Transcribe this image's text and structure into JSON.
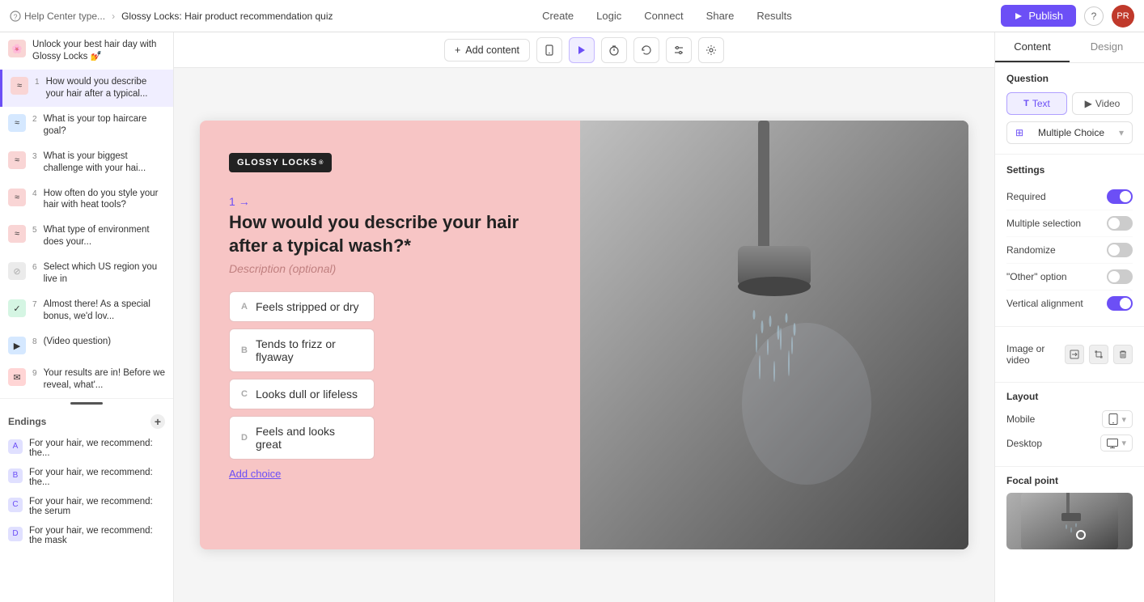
{
  "topnav": {
    "help_center": "Help Center type...",
    "breadcrumb_sep": "›",
    "breadcrumb_current": "Glossy Locks: Hair product recommendation quiz",
    "nav_items": [
      "Create",
      "Logic",
      "Connect",
      "Share",
      "Results"
    ],
    "publish_label": "Publish",
    "avatar_initials": "PR"
  },
  "sidebar": {
    "questions": [
      {
        "num": "",
        "text": "Unlock your best hair day with Glossy Locks 💅",
        "icon_type": "pink",
        "icon": "🌸"
      },
      {
        "num": "1",
        "text": "How would you describe your hair after a typical...",
        "icon_type": "pink",
        "icon": "≈"
      },
      {
        "num": "2",
        "text": "What is your top haircare goal?",
        "icon_type": "blue",
        "icon": "≈"
      },
      {
        "num": "3",
        "text": "What is your biggest challenge with your hai...",
        "icon_type": "pink",
        "icon": "≈"
      },
      {
        "num": "4",
        "text": "How often do you style your hair with heat tools?",
        "icon_type": "pink",
        "icon": "≈"
      },
      {
        "num": "5",
        "text": "What type of environment does your...",
        "icon_type": "pink",
        "icon": "≈"
      },
      {
        "num": "6",
        "text": "Select which US region you live in",
        "icon_type": "gray",
        "icon": "⊘"
      },
      {
        "num": "7",
        "text": "Almost there! As a special bonus, we'd lov...",
        "icon_type": "green",
        "icon": "✓"
      },
      {
        "num": "8",
        "text": "(Video question)",
        "icon_type": "blue",
        "icon": "▶"
      },
      {
        "num": "9",
        "text": "Your results are in! Before we reveal, what'...",
        "icon_type": "red",
        "icon": "✉"
      }
    ],
    "endings_label": "Endings",
    "endings": [
      {
        "badge": "A",
        "text": "For your hair, we recommend: the..."
      },
      {
        "badge": "B",
        "text": "For your hair, we recommend: the..."
      },
      {
        "badge": "C",
        "text": "For your hair, we recommend: the serum"
      },
      {
        "badge": "D",
        "text": "For your hair, we recommend: the mask"
      }
    ]
  },
  "toolbar": {
    "add_content_label": "+ Add content",
    "buttons": [
      "mobile",
      "play",
      "timer",
      "refresh",
      "settings-sliders",
      "gear"
    ]
  },
  "canvas": {
    "logo_text": "GLOSSY LOCKS",
    "logo_sup": "®",
    "question_num": "1",
    "question_arrow": "→",
    "question_text": "How would you describe your hair after a typical wash?*",
    "description_placeholder": "Description (optional)",
    "choices": [
      {
        "letter": "A",
        "text": "Feels stripped or dry"
      },
      {
        "letter": "B",
        "text": "Tends to frizz or flyaway"
      },
      {
        "letter": "C",
        "text": "Looks dull or lifeless"
      },
      {
        "letter": "D",
        "text": "Feels and looks great"
      }
    ],
    "add_choice_label": "Add choice"
  },
  "right_panel": {
    "tabs": [
      "Content",
      "Design"
    ],
    "active_tab": "Content",
    "question_section_title": "Question",
    "type_buttons": [
      {
        "label": "Text",
        "icon": "T",
        "active": true
      },
      {
        "label": "Video",
        "icon": "▶",
        "active": false
      }
    ],
    "multiple_choice_label": "Multiple Choice",
    "settings_title": "Settings",
    "settings": [
      {
        "label": "Required",
        "toggle": true
      },
      {
        "label": "Multiple selection",
        "toggle": false
      },
      {
        "label": "Randomize",
        "toggle": false
      },
      {
        "label": "\"Other\" option",
        "toggle": false
      },
      {
        "label": "Vertical alignment",
        "toggle": true
      }
    ],
    "image_video_label": "Image or video",
    "layout_title": "Layout",
    "layout_options": [
      {
        "label": "Mobile",
        "icon": "📱"
      },
      {
        "label": "Desktop",
        "icon": "🖥"
      }
    ],
    "focal_point_title": "Focal point"
  }
}
